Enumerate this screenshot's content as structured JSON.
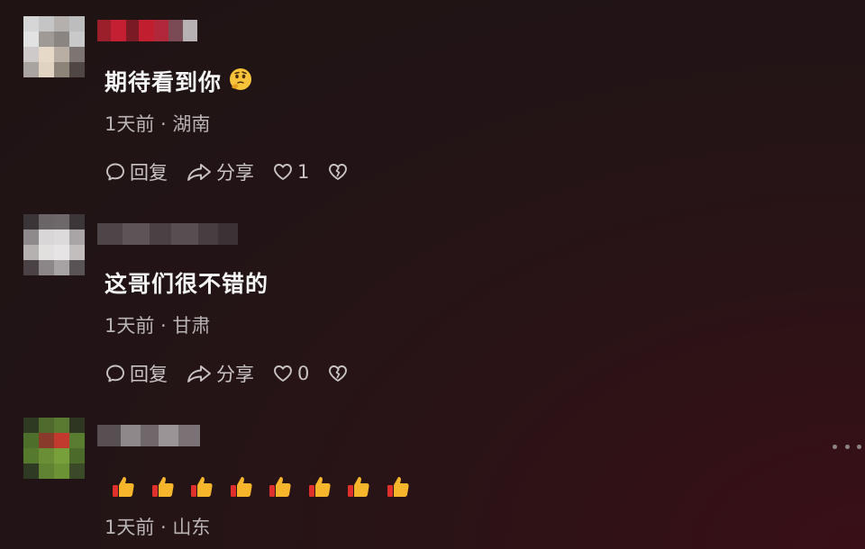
{
  "comments": [
    {
      "text": "期待看到你",
      "meta": "1天前 · 湖南",
      "reply_label": "回复",
      "share_label": "分享",
      "like_count": "1",
      "has_emoji": "thinking-face"
    },
    {
      "text": "这哥们很不错的",
      "meta": "1天前 · 甘肃",
      "reply_label": "回复",
      "share_label": "分享",
      "like_count": "0"
    },
    {
      "text": "",
      "emoji_sequence": [
        "thumbs-up",
        "thumbs-up",
        "thumbs-up",
        "thumbs-up",
        "thumbs-up",
        "thumbs-up",
        "thumbs-up",
        "thumbs-up"
      ],
      "meta": "1天前 · 山东"
    }
  ],
  "icons": {
    "reply": "comment-bubble-icon",
    "share": "share-arrow-icon",
    "like": "heart-icon",
    "dislike": "broken-heart-icon",
    "more": "more-dots-icon"
  },
  "colors": {
    "background": "#221416",
    "text": "#f4f4f4",
    "meta": "#b9b4b4",
    "action": "#c9c4c4",
    "accent_red": "#b01e2e"
  }
}
